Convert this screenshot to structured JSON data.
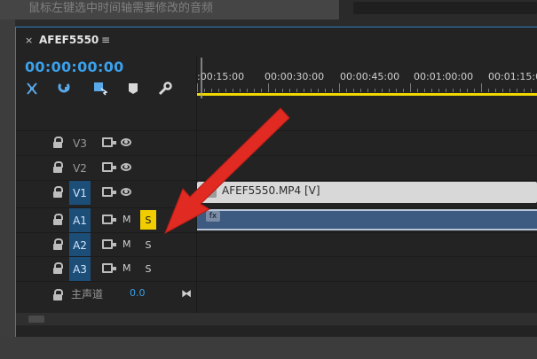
{
  "top_caption": "鼠标左键选中时间轴需要修改的音频",
  "sequence": {
    "tab_title": "AFEF5550",
    "timecode": "00:00:00:00"
  },
  "ruler": {
    "labels": [
      ":00:15:00",
      "00:00:30:00",
      "00:00:45:00",
      "00:01:00:00",
      "00:01:15:00"
    ]
  },
  "tracks": [
    {
      "name": "V1",
      "type": "video",
      "active": true
    },
    {
      "name": "V2",
      "type": "video",
      "active": false
    },
    {
      "name": "V3",
      "type": "video",
      "active": false
    }
  ],
  "track_labels": {
    "v3": "V3",
    "v2": "V2",
    "v1": "V1",
    "a1": "A1",
    "a2": "A2",
    "a3": "A3",
    "m": "M",
    "s": "S"
  },
  "clips": {
    "video": "AFEF5550.MP4 [V]",
    "audio_fx": "fx"
  },
  "master": {
    "label": "主声道",
    "value": "0.0"
  },
  "colors": {
    "accent": "#2a80c4",
    "timecode": "#3aa0ea",
    "solo": "#f1cd00",
    "ruler_line": "#f0d800",
    "arrow": "#e02a22"
  },
  "icons": [
    "close-icon",
    "menu-icon",
    "snap-icon",
    "link-icon",
    "marker-tool-icon",
    "bookmark-icon",
    "wrench-icon",
    "lock-icon",
    "film-icon",
    "eye-icon",
    "master-output-icon",
    "arrow-annotation"
  ]
}
